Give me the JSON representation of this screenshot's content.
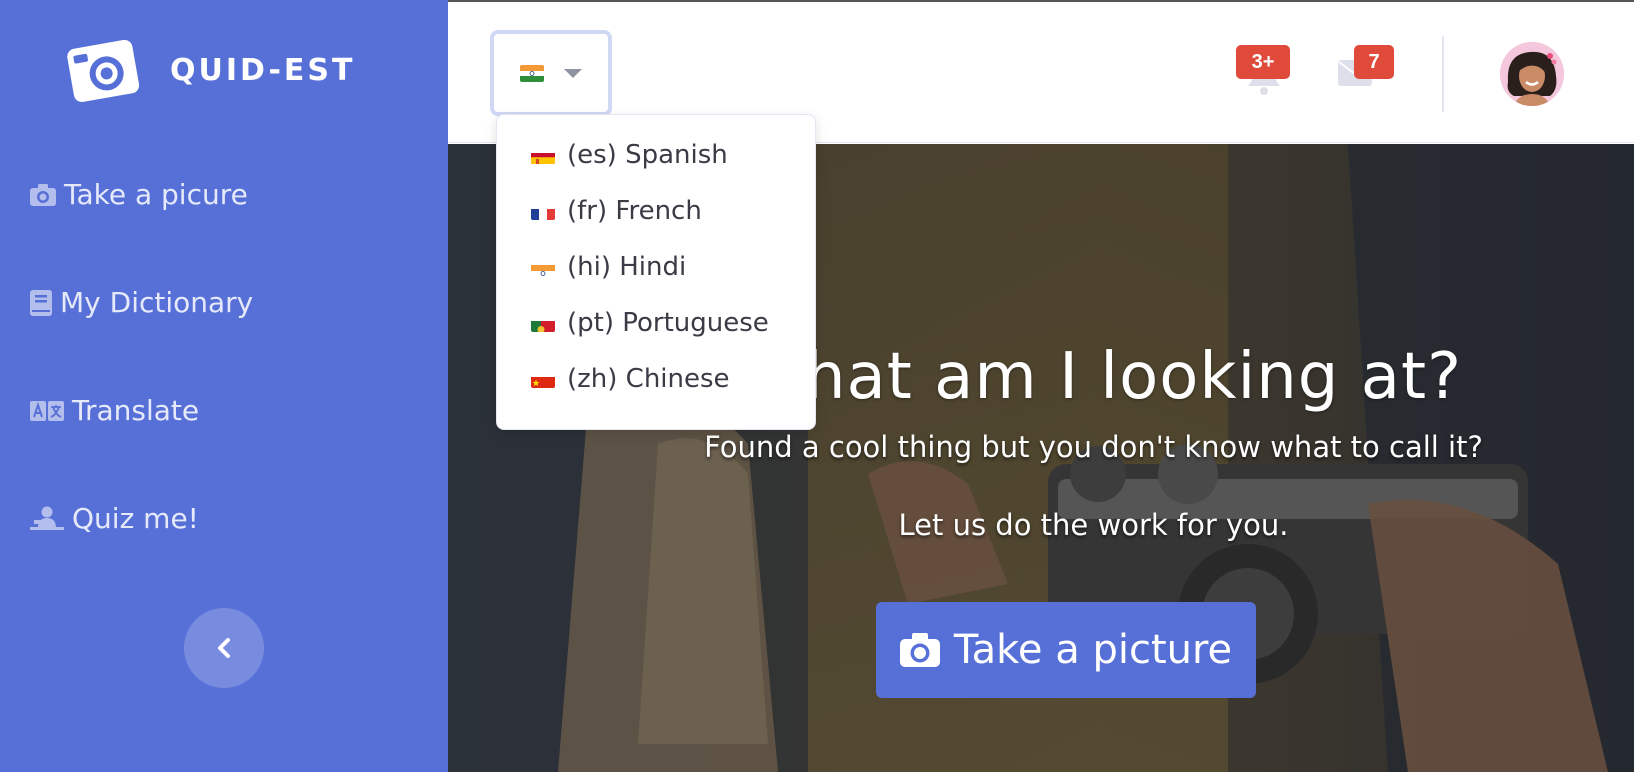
{
  "brand": {
    "name": "QUID-EST"
  },
  "sidebar": {
    "items": [
      {
        "label": "Take a picure",
        "icon": "camera-icon"
      },
      {
        "label": "My Dictionary",
        "icon": "book-icon"
      },
      {
        "label": "Translate",
        "icon": "language-icon"
      },
      {
        "label": "Quiz me!",
        "icon": "chalkboard-teacher-icon"
      }
    ],
    "collapse_icon": "chevron-left-icon"
  },
  "topbar": {
    "language_selected": "hi",
    "alerts_badge": "3+",
    "messages_badge": "7"
  },
  "language_menu": {
    "items": [
      {
        "code": "es",
        "label": "(es) Spanish"
      },
      {
        "code": "fr",
        "label": "(fr) French"
      },
      {
        "code": "hi",
        "label": "(hi) Hindi"
      },
      {
        "code": "pt",
        "label": "(pt) Portuguese"
      },
      {
        "code": "zh",
        "label": "(zh) Chinese"
      }
    ]
  },
  "hero": {
    "title": "hat am I looking at?",
    "subtitle": "Found a cool thing but you don't know what to call it?",
    "tagline": "Let us do the work for you.",
    "button_label": "Take a picture"
  },
  "colors": {
    "primary": "#5770d8",
    "badge": "#e04a3b",
    "text_dark": "#3a3b45"
  }
}
